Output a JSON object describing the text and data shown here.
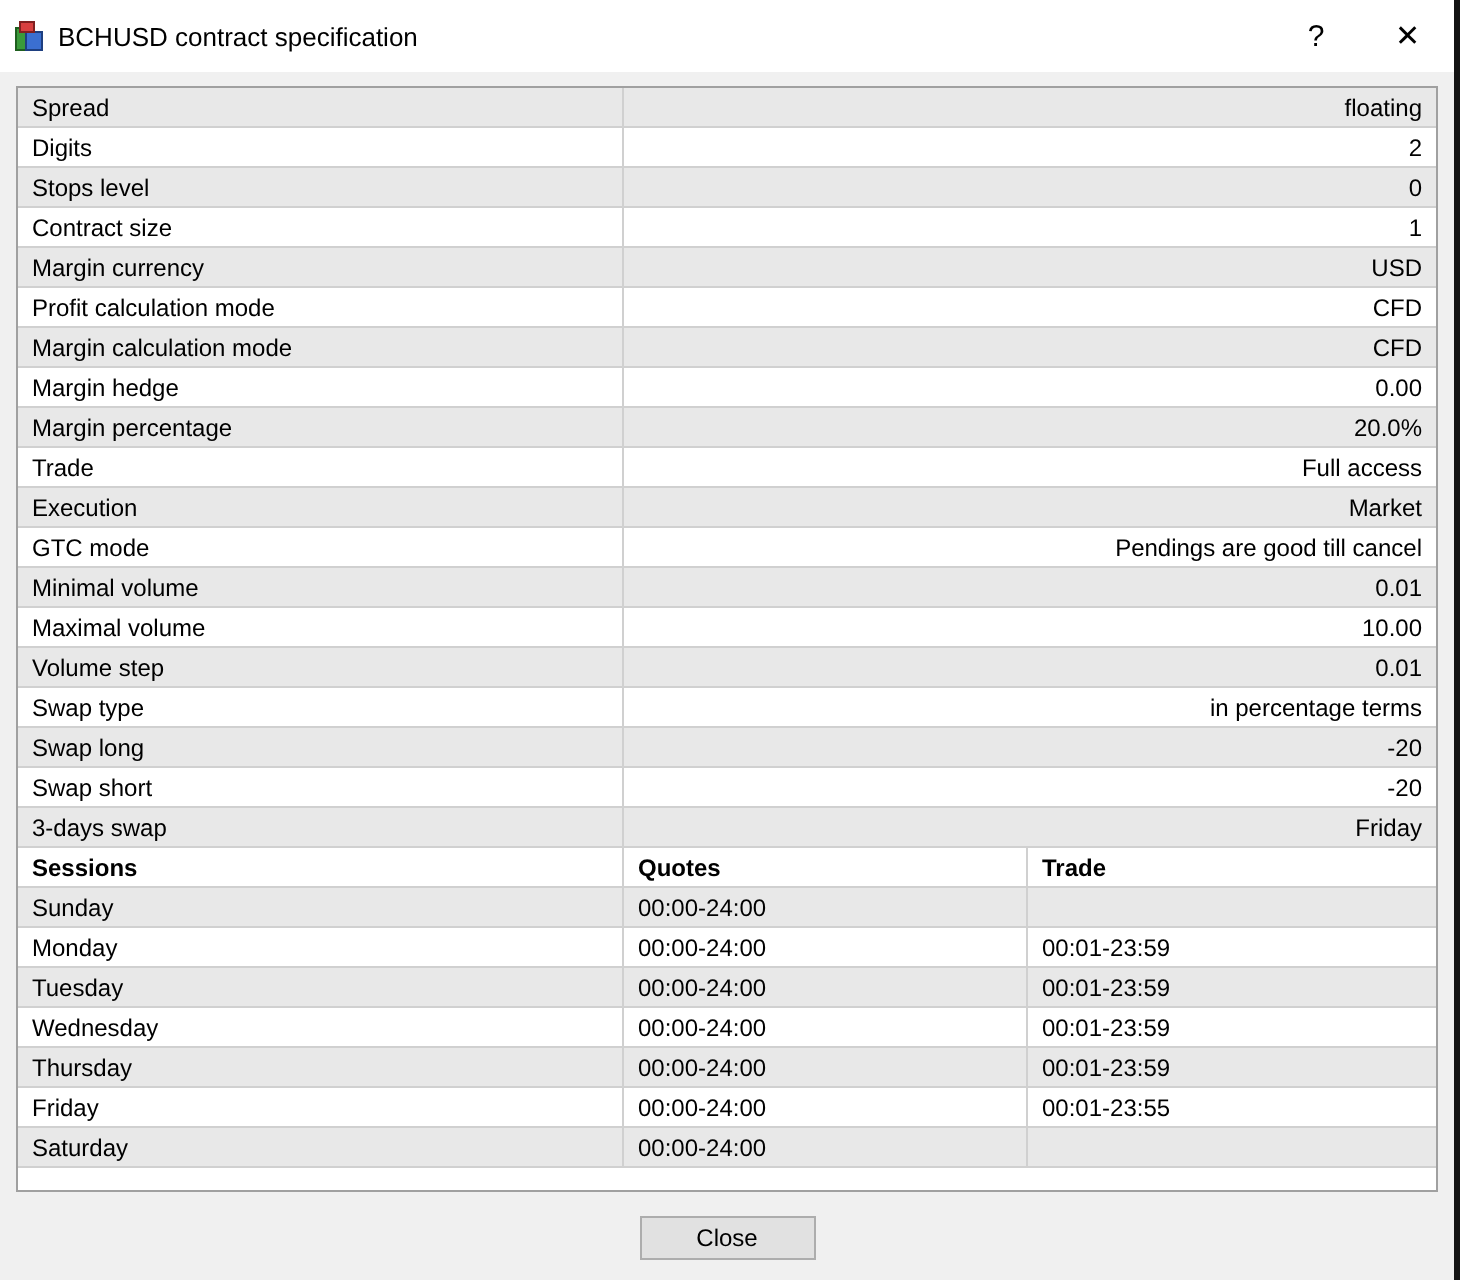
{
  "window": {
    "title": "BCHUSD contract specification",
    "help": "?",
    "close": "✕"
  },
  "specification": [
    {
      "name": "Spread",
      "value": "floating"
    },
    {
      "name": "Digits",
      "value": "2"
    },
    {
      "name": "Stops level",
      "value": "0"
    },
    {
      "name": "Contract size",
      "value": "1"
    },
    {
      "name": "Margin currency",
      "value": "USD"
    },
    {
      "name": "Profit calculation mode",
      "value": "CFD"
    },
    {
      "name": "Margin calculation mode",
      "value": "CFD"
    },
    {
      "name": "Margin hedge",
      "value": "0.00"
    },
    {
      "name": "Margin percentage",
      "value": "20.0%"
    },
    {
      "name": "Trade",
      "value": "Full access"
    },
    {
      "name": "Execution",
      "value": "Market"
    },
    {
      "name": "GTC mode",
      "value": "Pendings are good till cancel"
    },
    {
      "name": "Minimal volume",
      "value": "0.01"
    },
    {
      "name": "Maximal volume",
      "value": "10.00"
    },
    {
      "name": "Volume step",
      "value": "0.01"
    },
    {
      "name": "Swap type",
      "value": "in percentage terms"
    },
    {
      "name": "Swap long",
      "value": "-20"
    },
    {
      "name": "Swap short",
      "value": "-20"
    },
    {
      "name": "3-days swap",
      "value": "Friday"
    }
  ],
  "sessions": {
    "columns": [
      "Sessions",
      "Quotes",
      "Trade"
    ],
    "rows": [
      {
        "day": "Sunday",
        "quotes": "00:00-24:00"
      },
      {
        "day": "Monday",
        "quotes": "00:00-24:00",
        "trade": "00:01-23:59"
      },
      {
        "day": "Tuesday",
        "quotes": "00:00-24:00",
        "trade": "00:01-23:59"
      },
      {
        "day": "Wednesday",
        "quotes": "00:00-24:00",
        "trade": "00:01-23:59"
      },
      {
        "day": "Thursday",
        "quotes": "00:00-24:00",
        "trade": "00:01-23:59"
      },
      {
        "day": "Friday",
        "quotes": "00:00-24:00",
        "trade": "00:01-23:55"
      },
      {
        "day": "Saturday",
        "quotes": "00:00-24:00"
      }
    ]
  },
  "buttons": [
    "Close"
  ]
}
